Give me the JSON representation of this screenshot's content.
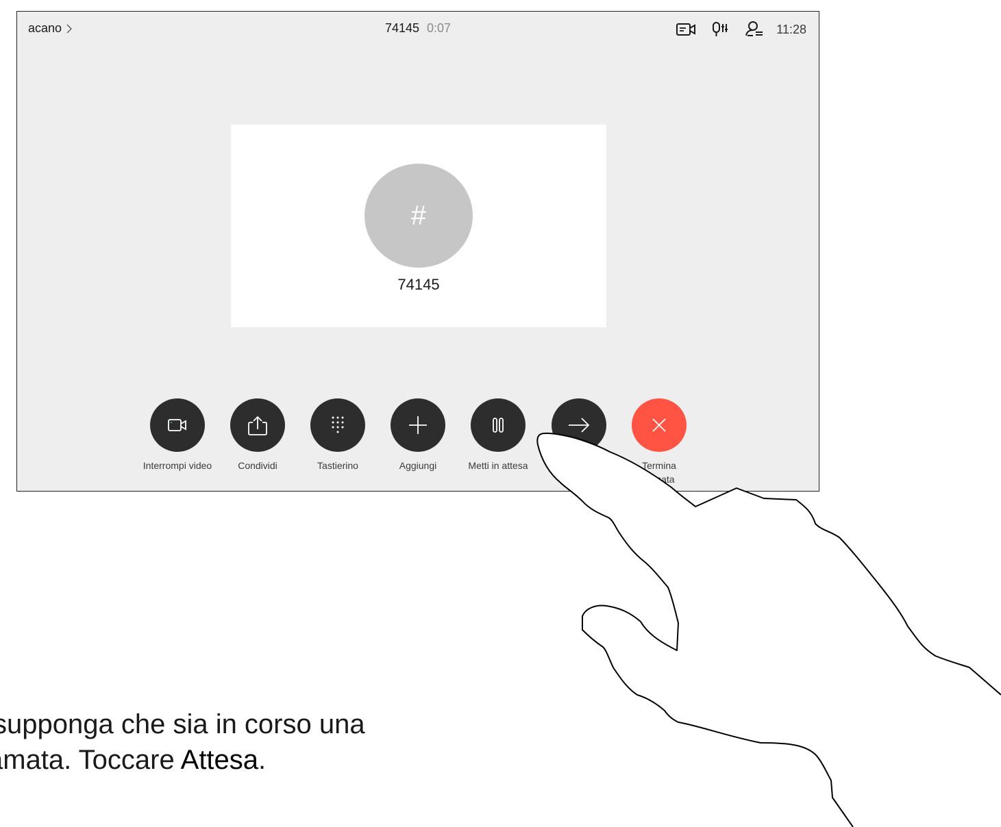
{
  "header": {
    "breadcrumb_label": "acano",
    "call_number": "74145",
    "call_timer": "0:07",
    "clock": "11:28"
  },
  "status_icons": [
    "camera-status-icon",
    "microphone-status-icon",
    "participants-icon"
  ],
  "contact": {
    "avatar_glyph": "#",
    "name": "74145"
  },
  "controls": [
    {
      "id": "interrompi-video",
      "label": "Interrompi video",
      "icon": "video-camera-icon"
    },
    {
      "id": "condividi",
      "label": "Condividi",
      "icon": "share-icon"
    },
    {
      "id": "tastierino",
      "label": "Tastierino",
      "icon": "keypad-icon"
    },
    {
      "id": "aggiungi",
      "label": "Aggiungi",
      "icon": "plus-icon"
    },
    {
      "id": "metti-in-attesa",
      "label": "Metti in attesa",
      "icon": "pause-icon"
    },
    {
      "id": "trasferisci",
      "label": "",
      "icon": "arrow-right-icon"
    },
    {
      "id": "termina-chiamata",
      "label": "Termina chiamata",
      "label_line1": "Termina",
      "label_line2": "mata",
      "icon": "close-icon"
    }
  ],
  "colors": {
    "screen_bg": "#eeeeee",
    "button_bg": "#2d2d2d",
    "end_call": "#ff5343",
    "avatar": "#c6c6c6"
  },
  "caption": {
    "line1": "supponga che sia in corso una",
    "line2_prefix": "amata. Toccare ",
    "line2_bold": "Attesa",
    "line2_suffix": "."
  }
}
